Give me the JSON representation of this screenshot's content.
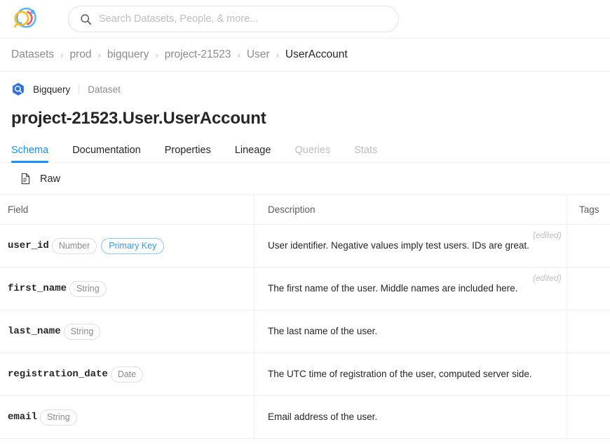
{
  "app": {
    "logo_icon": "datahub-logo-icon",
    "accent_color": "#1890ff"
  },
  "search": {
    "icon": "search-icon",
    "placeholder": "Search Datasets, People, & more...",
    "value": ""
  },
  "breadcrumb": {
    "separator": "›",
    "items": [
      {
        "label": "Datasets",
        "current": false
      },
      {
        "label": "prod",
        "current": false
      },
      {
        "label": "bigquery",
        "current": false
      },
      {
        "label": "project-21523",
        "current": false
      },
      {
        "label": "User",
        "current": false
      },
      {
        "label": "UserAccount",
        "current": true
      }
    ]
  },
  "header": {
    "platform_icon": "bigquery-icon",
    "platform": "Bigquery",
    "entity_type": "Dataset",
    "title": "project-21523.User.UserAccount"
  },
  "tabs": [
    {
      "label": "Schema",
      "state": "active"
    },
    {
      "label": "Documentation",
      "state": "enabled"
    },
    {
      "label": "Properties",
      "state": "enabled"
    },
    {
      "label": "Lineage",
      "state": "enabled"
    },
    {
      "label": "Queries",
      "state": "disabled"
    },
    {
      "label": "Stats",
      "state": "disabled"
    }
  ],
  "toolbar": {
    "raw_icon": "file-document-icon",
    "raw_label": "Raw"
  },
  "schema_table": {
    "columns": {
      "field": "Field",
      "description": "Description",
      "tags": "Tags"
    },
    "edited_label": "(edited)",
    "rows": [
      {
        "field": "user_id",
        "type": "Number",
        "primary_key_label": "Primary Key",
        "is_primary_key": true,
        "description": "User identifier. Negative values imply test users. IDs are great.",
        "edited": true,
        "tags": ""
      },
      {
        "field": "first_name",
        "type": "String",
        "primary_key_label": "",
        "is_primary_key": false,
        "description": "The first name of the user. Middle names are included here.",
        "edited": true,
        "tags": ""
      },
      {
        "field": "last_name",
        "type": "String",
        "primary_key_label": "",
        "is_primary_key": false,
        "description": "The last name of the user.",
        "edited": false,
        "tags": ""
      },
      {
        "field": "registration_date",
        "type": "Date",
        "primary_key_label": "",
        "is_primary_key": false,
        "description": "The UTC time of registration of the user, computed server side.",
        "edited": false,
        "tags": ""
      },
      {
        "field": "email",
        "type": "String",
        "primary_key_label": "",
        "is_primary_key": false,
        "description": "Email address of the user.",
        "edited": false,
        "tags": ""
      }
    ]
  }
}
